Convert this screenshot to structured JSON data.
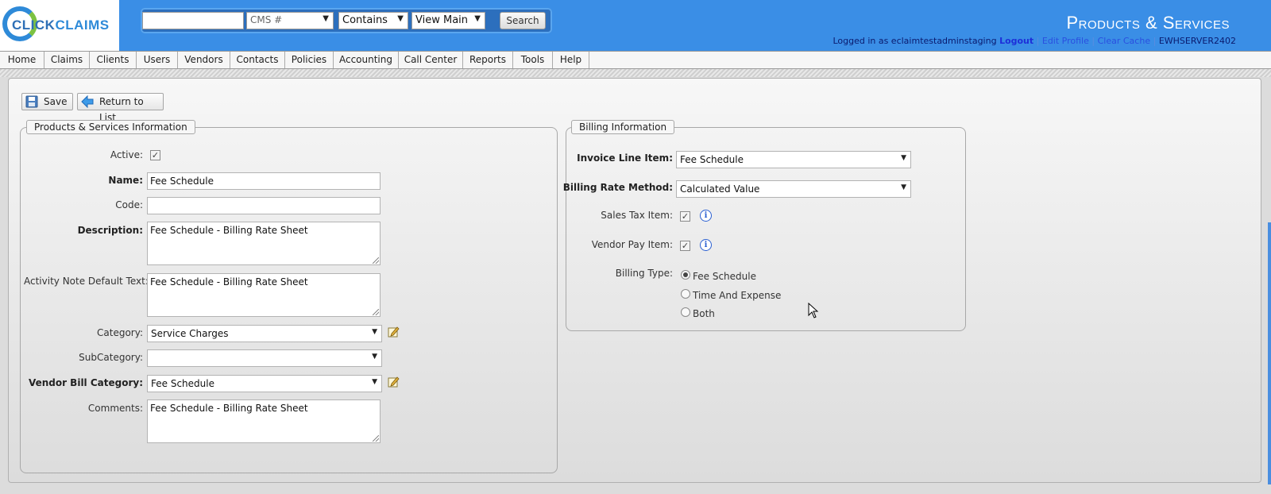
{
  "app": {
    "logo": {
      "part1": "CLICK",
      "part2": "CLAIMS"
    },
    "page_title": "Products & Services"
  },
  "search": {
    "query_value": "",
    "field_select": "CMS #",
    "operator_select": "Contains",
    "view_select": "View Main",
    "button_label": "Search"
  },
  "user_bar": {
    "logged_in_prefix": "Logged in as eclaimtestadminstaging",
    "logout": "Logout",
    "edit_profile": "Edit Profile",
    "clear_cache": "Clear Cache",
    "server": "EWHSERVER2402",
    "separator": "|"
  },
  "nav": {
    "items": [
      "Home",
      "Claims",
      "Clients",
      "Users",
      "Vendors",
      "Contacts",
      "Policies",
      "Accounting",
      "Call Center",
      "Reports",
      "Tools",
      "Help"
    ]
  },
  "toolbar": {
    "save_label": "Save",
    "return_label": "Return to List"
  },
  "product_info": {
    "legend": "Products & Services Information",
    "active_label": "Active:",
    "active_checked": true,
    "name_label": "Name:",
    "name_value": "Fee Schedule",
    "code_label": "Code:",
    "code_value": "",
    "description_label": "Description:",
    "description_value": "Fee Schedule - Billing Rate Sheet",
    "activity_note_label": "Activity Note Default Text:",
    "activity_note_value": "Fee Schedule - Billing Rate Sheet",
    "category_label": "Category:",
    "category_value": "Service Charges",
    "subcategory_label": "SubCategory:",
    "subcategory_value": "",
    "vendor_bill_category_label": "Vendor Bill Category:",
    "vendor_bill_category_value": "Fee Schedule",
    "comments_label": "Comments:",
    "comments_value": "Fee Schedule - Billing Rate Sheet"
  },
  "billing_info": {
    "legend": "Billing Information",
    "invoice_line_item_label": "Invoice Line Item:",
    "invoice_line_item_value": "Fee Schedule",
    "billing_rate_method_label": "Billing Rate Method:",
    "billing_rate_method_value": "Calculated Value",
    "sales_tax_label": "Sales Tax Item:",
    "sales_tax_checked": true,
    "vendor_pay_label": "Vendor Pay Item:",
    "vendor_pay_checked": true,
    "billing_type_label": "Billing Type:",
    "billing_type_options": [
      "Fee Schedule",
      "Time And Expense",
      "Both"
    ],
    "billing_type_selected": "Fee Schedule"
  },
  "icons": {
    "save": "floppy-disk-icon",
    "return": "back-arrow-icon",
    "info": "info-icon",
    "edit": "edit-pencil-icon"
  },
  "colors": {
    "header": "#3a8ee6",
    "search_bar": "#2c6fbd",
    "link": "#2a4fe0"
  }
}
